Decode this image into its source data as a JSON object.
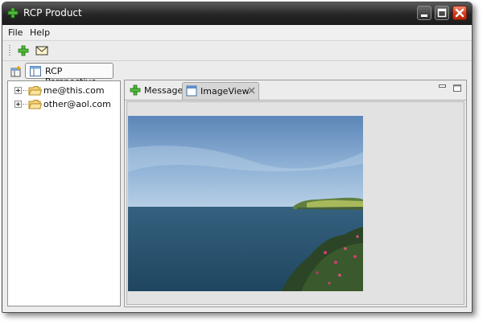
{
  "window": {
    "title": "RCP Product"
  },
  "menubar": {
    "items": [
      "File",
      "Help"
    ]
  },
  "toolbar": {
    "buttons": [
      {
        "icon": "add-icon"
      },
      {
        "icon": "mail-icon"
      }
    ]
  },
  "perspective": {
    "open_icon": "open-perspective-icon",
    "label": "RCP Perspective"
  },
  "tree": {
    "items": [
      {
        "label": "me@this.com",
        "icon": "folder-icon",
        "expander": "expand-plus-icon"
      },
      {
        "label": "other@aol.com",
        "icon": "folder-icon",
        "expander": "expand-plus-icon"
      }
    ]
  },
  "editor": {
    "tabs": [
      {
        "label": "Message",
        "icon": "add-icon",
        "active": false
      },
      {
        "label": "ImageView",
        "icon": "view-icon",
        "active": true
      }
    ],
    "image_description_icon": "landscape-photo"
  },
  "colors": {
    "titlebar": "#262626",
    "close_button": "#d33a1c",
    "accent_green": "#2e9a2e"
  }
}
